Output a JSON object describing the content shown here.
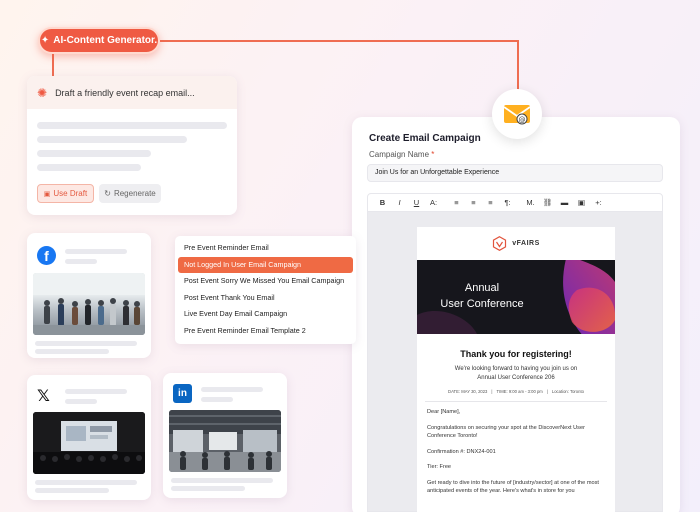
{
  "ai_generator": {
    "pill_label": "AI-Content Generator.",
    "prompt_text": "Draft a friendly event recap email...",
    "use_draft_label": "Use Draft",
    "regenerate_label": "Regenerate"
  },
  "templates": {
    "items": [
      "Pre Event Reminder Email",
      "Not Logged In User Email Campaign",
      "Post Event Sorry We Missed You Email Campaign",
      "Post Event Thank You Email",
      "Live Event Day Email Campaign",
      "Pre Event Reminder Email Template 2"
    ],
    "selected_index": 1
  },
  "social": {
    "facebook_icon": "f",
    "x_icon": "𝕏",
    "linkedin_icon": "in"
  },
  "campaign": {
    "title": "Create Email Campaign",
    "name_label": "Campaign Name",
    "required_mark": "*",
    "name_value": "Join Us for an Unforgettable Experience",
    "toolbar": [
      "B",
      "I",
      "U",
      "A:",
      "≡",
      "≡",
      "≡",
      "¶:",
      "M.",
      "🔗",
      "▬",
      "▣",
      "+:"
    ]
  },
  "email": {
    "brand": "vFAIRS",
    "banner_line1": "Annual",
    "banner_line2": "User Conference",
    "thanks": "Thank you for registering!",
    "sub_line1": "We're looking forward to having you join us on",
    "sub_line2": "Annual User Conference 206",
    "date": "DATE: MAY 30, 2023",
    "time": "TIME: 9:00 am - 3:00 pm",
    "location": "Location: Toronto",
    "greeting": "Dear [Name],",
    "congrats": "Congratulations on securing your spot at the DiscoverNext User Conference Toronto!",
    "confirmation": "Confirmation #: DNX24-001",
    "tier": "Tier: Free",
    "closing": "Get ready to dive into the future of [industry/sector] at one of the most anticipated events of the year. Here's what's in store for you"
  },
  "colors": {
    "accent": "#ef5a43",
    "dropdown_active": "#ef6a44",
    "facebook": "#1877f2",
    "linkedin": "#0a66c2"
  }
}
